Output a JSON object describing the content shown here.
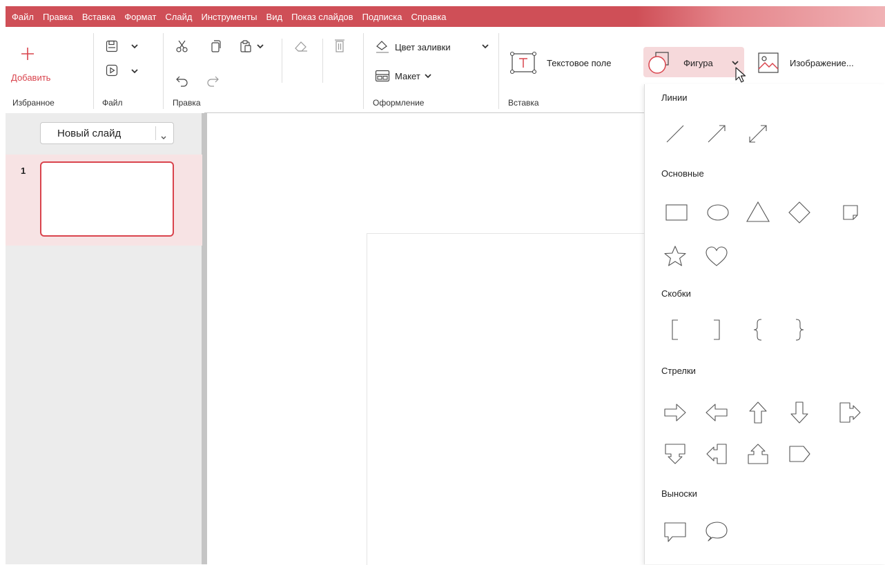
{
  "menu": {
    "items": [
      "Файл",
      "Правка",
      "Вставка",
      "Формат",
      "Слайд",
      "Инструменты",
      "Вид",
      "Показ слайдов",
      "Подписка",
      "Справка"
    ],
    "bg_color": "#cf4f57"
  },
  "ribbon": {
    "add_label": "Добавить",
    "groups": {
      "favorites": "Избранное",
      "file": "Файл",
      "edit": "Правка",
      "design": "Оформление",
      "insert": "Вставка"
    },
    "fill_color_label": "Цвет заливки",
    "layout_label": "Макет",
    "textbox_label": "Текстовое поле",
    "shape_label": "Фигура",
    "image_label": "Изображение..."
  },
  "slides_panel": {
    "new_slide_label": "Новый слайд",
    "slides": [
      {
        "number": "1"
      }
    ]
  },
  "shape_menu": {
    "sections": {
      "lines": "Линии",
      "basic": "Основные",
      "brackets": "Скобки",
      "arrows": "Стрелки",
      "callouts": "Выноски"
    },
    "icons": {
      "lines": [
        "line-icon",
        "arrow-line-icon",
        "double-arrow-line-icon"
      ],
      "basic": [
        "rectangle-icon",
        "ellipse-icon",
        "triangle-icon",
        "diamond-icon",
        "folded-corner-icon",
        "star-icon",
        "heart-icon"
      ],
      "brackets": [
        "left-bracket-icon",
        "right-bracket-icon",
        "left-brace-icon",
        "right-brace-icon"
      ],
      "arrows": [
        "right-arrow-icon",
        "left-arrow-icon",
        "up-arrow-icon",
        "down-arrow-icon",
        "right-arrow-callout-icon",
        "down-arrow-callout-icon",
        "left-arrow-callout-icon",
        "up-arrow-callout-icon",
        "pentagon-arrow-icon"
      ],
      "callouts": [
        "rectangular-callout-icon",
        "oval-callout-icon"
      ]
    }
  },
  "colors": {
    "accent": "#d9434c",
    "shape_button_bg": "#f6d9db"
  }
}
